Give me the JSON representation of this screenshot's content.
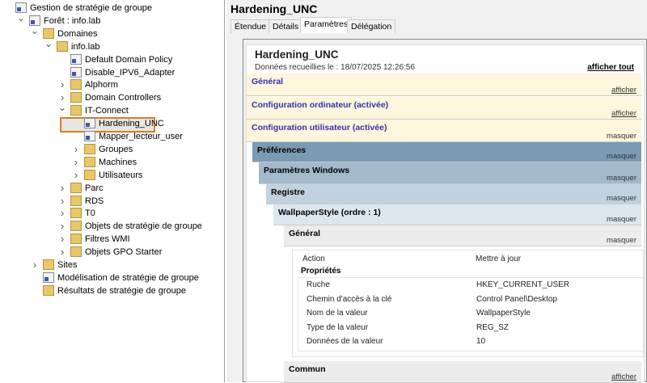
{
  "tree": [
    {
      "label": "Gestion de stratégie de groupe",
      "depth": 0,
      "chev": "",
      "icon": "console"
    },
    {
      "label": "Forêt : info.lab",
      "depth": 1,
      "chev": "v",
      "icon": "forest"
    },
    {
      "label": "Domaines",
      "depth": 2,
      "chev": "v",
      "icon": "folder"
    },
    {
      "label": "info.lab",
      "depth": 3,
      "chev": "v",
      "icon": "domain"
    },
    {
      "label": "Default Domain Policy",
      "depth": 4,
      "chev": "",
      "icon": "gpo"
    },
    {
      "label": "Disable_IPV6_Adapter",
      "depth": 4,
      "chev": "",
      "icon": "gpo"
    },
    {
      "label": "Alphorm",
      "depth": 4,
      "chev": ">",
      "icon": "folder"
    },
    {
      "label": "Domain Controllers",
      "depth": 4,
      "chev": ">",
      "icon": "folder"
    },
    {
      "label": "IT-Connect",
      "depth": 4,
      "chev": "v",
      "icon": "folder"
    },
    {
      "label": "Hardening_UNC",
      "depth": 5,
      "chev": "",
      "icon": "gpo"
    },
    {
      "label": "Mapper_lecteur_user",
      "depth": 5,
      "chev": "",
      "icon": "gpo"
    },
    {
      "label": "Groupes",
      "depth": 5,
      "chev": ">",
      "icon": "folder"
    },
    {
      "label": "Machines",
      "depth": 5,
      "chev": ">",
      "icon": "folder"
    },
    {
      "label": "Utilisateurs",
      "depth": 5,
      "chev": ">",
      "icon": "folder"
    },
    {
      "label": "Parc",
      "depth": 4,
      "chev": ">",
      "icon": "folder"
    },
    {
      "label": "RDS",
      "depth": 4,
      "chev": ">",
      "icon": "folder"
    },
    {
      "label": "T0",
      "depth": 4,
      "chev": ">",
      "icon": "folder"
    },
    {
      "label": "Objets de stratégie de groupe",
      "depth": 4,
      "chev": ">",
      "icon": "folder"
    },
    {
      "label": "Filtres WMI",
      "depth": 4,
      "chev": ">",
      "icon": "folder"
    },
    {
      "label": "Objets GPO Starter",
      "depth": 4,
      "chev": ">",
      "icon": "folder"
    },
    {
      "label": "Sites",
      "depth": 2,
      "chev": ">",
      "icon": "folder"
    },
    {
      "label": "Modélisation de stratégie de groupe",
      "depth": 2,
      "chev": "",
      "icon": "console"
    },
    {
      "label": "Résultats de stratégie de groupe",
      "depth": 2,
      "chev": "",
      "icon": "folder"
    }
  ],
  "right": {
    "title": "Hardening_UNC",
    "tabs": [
      "Étendue",
      "Détails",
      "Paramètres",
      "Délégation"
    ],
    "report": {
      "title": "Hardening_UNC",
      "collected": "Données recueillies le : 18/07/2025 12:26:56",
      "show_all": "afficher tout",
      "sections": [
        {
          "label": "Général",
          "toggle": "afficher"
        },
        {
          "label": "Configuration ordinateur (activée)",
          "toggle": "afficher"
        },
        {
          "label": "Configuration utilisateur (activée)",
          "toggle": "masquer"
        },
        {
          "label": "Préférences",
          "toggle": "masquer"
        },
        {
          "label": "Paramètres Windows",
          "toggle": "masquer"
        },
        {
          "label": "Registre",
          "toggle": "masquer"
        },
        {
          "label": "WallpaperStyle (ordre : 1)",
          "toggle": "masquer"
        },
        {
          "label": "Général",
          "toggle": "masquer"
        },
        {
          "label": "Commun",
          "toggle": "afficher"
        }
      ],
      "action_label": "Action",
      "action_value": "Mettre à jour",
      "props_title": "Propriétés",
      "props": [
        {
          "k": "Ruche",
          "v": "HKEY_CURRENT_USER"
        },
        {
          "k": "Chemin d'accès à la clé",
          "v": "Control Panel\\Desktop"
        },
        {
          "k": "Nom de la valeur",
          "v": "WallpaperStyle"
        },
        {
          "k": "Type de la valeur",
          "v": "REG_SZ"
        },
        {
          "k": "Données de la valeur",
          "v": "10"
        }
      ]
    }
  }
}
